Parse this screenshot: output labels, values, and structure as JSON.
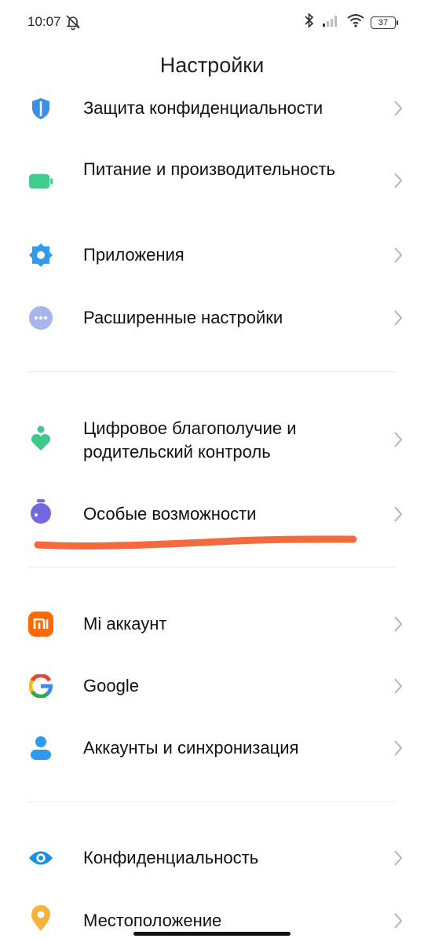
{
  "status_bar": {
    "time": "10:07",
    "battery": "37"
  },
  "header": {
    "title": "Настройки"
  },
  "sections": [
    {
      "items": [
        {
          "label": "Защита конфиденциальности",
          "icon": "shield-icon"
        },
        {
          "label": "Питание и производительность",
          "icon": "battery-icon"
        },
        {
          "label": "Приложения",
          "icon": "gear-icon"
        },
        {
          "label": "Расширенные настройки",
          "icon": "more-icon"
        }
      ]
    },
    {
      "items": [
        {
          "label": "Цифровое благополучие и родительский контроль",
          "icon": "wellbeing-icon"
        },
        {
          "label": "Особые возможности",
          "icon": "accessibility-icon"
        }
      ]
    },
    {
      "items": [
        {
          "label": "Mi аккаунт",
          "icon": "mi-icon",
          "icon_text": "mi"
        },
        {
          "label": "Google",
          "icon": "google-icon",
          "icon_text": "G"
        },
        {
          "label": "Аккаунты и синхронизация",
          "icon": "account-icon"
        }
      ]
    },
    {
      "items": [
        {
          "label": "Конфиденциальность",
          "icon": "eye-icon"
        },
        {
          "label": "Местоположение",
          "icon": "location-icon"
        }
      ]
    }
  ],
  "colors": {
    "shield": "#3d8ee6",
    "battery": "#3ecf8e",
    "gear": "#2f9bea",
    "more": "#a8b5ec",
    "wellbeing": "#3ec98a",
    "accessibility": "#7368e3",
    "mi": "#ff6900",
    "account": "#2d9af0",
    "eye": "#1b8fe6",
    "location": "#f6b23c",
    "annotation": "#f26a3d"
  }
}
